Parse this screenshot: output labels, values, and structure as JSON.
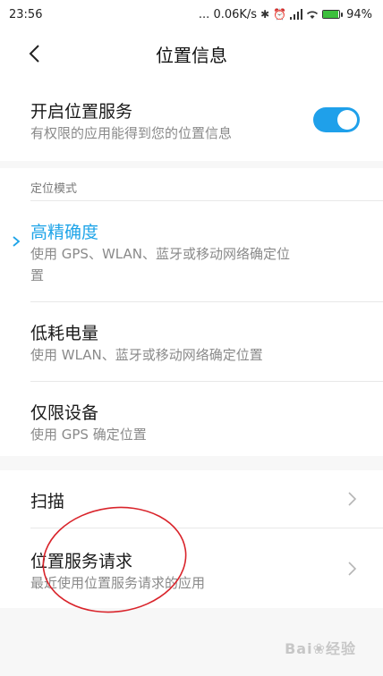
{
  "status": {
    "time": "23:56",
    "net": "... 0.06K/s",
    "battery_pct": "94%",
    "battery_level": 0.94
  },
  "header": {
    "title": "位置信息"
  },
  "location_service": {
    "title": "开启位置服务",
    "subtitle": "有权限的应用能得到您的位置信息",
    "enabled": true
  },
  "mode": {
    "section_label": "定位模式",
    "options": [
      {
        "title": "高精确度",
        "subtitle_1": "使用 GPS、WLAN、蓝牙或移动网络确定位",
        "subtitle_2": "置",
        "selected": true
      },
      {
        "title": "低耗电量",
        "subtitle": "使用 WLAN、蓝牙或移动网络确定位置",
        "selected": false
      },
      {
        "title": "仅限设备",
        "subtitle": "使用 GPS 确定位置",
        "selected": false
      }
    ]
  },
  "other": {
    "scan": {
      "title": "扫描"
    },
    "requests": {
      "title": "位置服务请求",
      "subtitle": "最近使用位置服务请求的应用"
    }
  },
  "colors": {
    "accent": "#1ea4e8",
    "annotation": "#d9242b"
  }
}
